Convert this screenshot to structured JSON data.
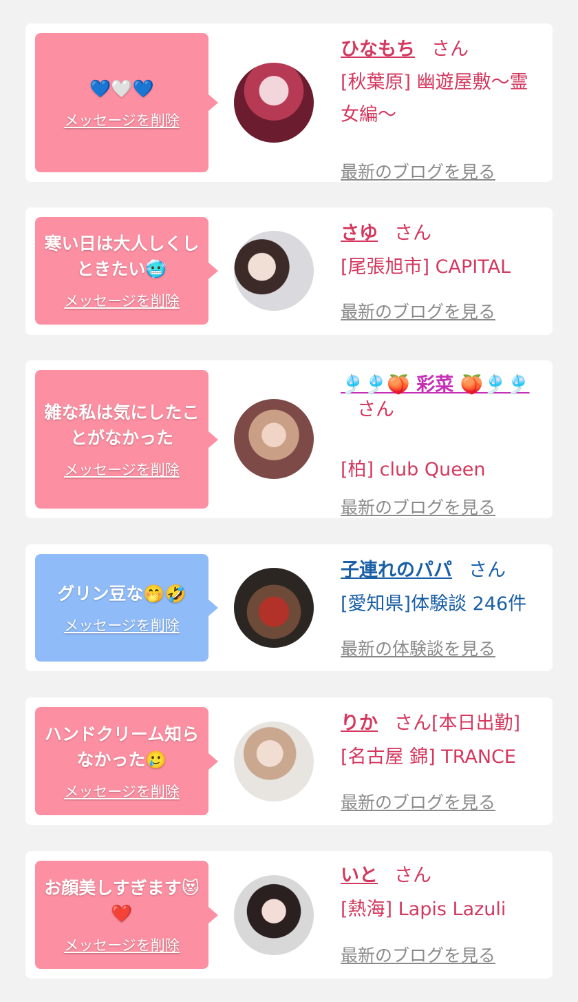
{
  "cards": [
    {
      "message": "💙🤍💙",
      "delete_label": "メッセージを削除",
      "name": "ひなもち",
      "honorific": "さん",
      "shop": "[秋葉原] 幽遊屋敷～霊女編～",
      "link": "最新のブログを見る",
      "theme": "pink"
    },
    {
      "message": "寒い日は大人しくしときたい🥶",
      "delete_label": "メッセージを削除",
      "name": "さゆ",
      "honorific": "さん",
      "shop": "[尾張旭市] CAPITAL",
      "link": "最新のブログを見る",
      "theme": "pink"
    },
    {
      "message": "雑な私は気にしたことがなかった",
      "delete_label": "メッセージを削除",
      "name": "🎐🎐🍑 彩菜 🍑🎐🎐",
      "honorific": "さん",
      "shop": "[柏] club Queen",
      "link": "最新のブログを見る",
      "theme": "pink"
    },
    {
      "message": "グリン豆な🤭🤣",
      "delete_label": "メッセージを削除",
      "name": "子連れのパパ",
      "honorific": "さん",
      "shop": "[愛知県]体験談 246件",
      "link": "最新の体験談を見る",
      "theme": "blue"
    },
    {
      "message": "ハンドクリーム知らなかった🥲",
      "delete_label": "メッセージを削除",
      "name": "りか",
      "honorific": "さん[本日出勤]",
      "shop": "[名古屋 錦] TRANCE",
      "link": "最新のブログを見る",
      "theme": "pink"
    },
    {
      "message": "お顔美しすぎます😻❤️",
      "delete_label": "メッセージを削除",
      "name": "いと",
      "honorific": "さん",
      "shop": "[熱海] Lapis Lazuli",
      "link": "最新のブログを見る",
      "theme": "pink"
    }
  ],
  "colors": {
    "background": "#f2f2f2",
    "card": "#ffffff",
    "bubble_pink": "#fd8fa2",
    "bubble_blue": "#8fbcf9",
    "name_pink": "#d4385e",
    "name_blue": "#1a5fa6",
    "link_gray": "#8a8a8a"
  }
}
